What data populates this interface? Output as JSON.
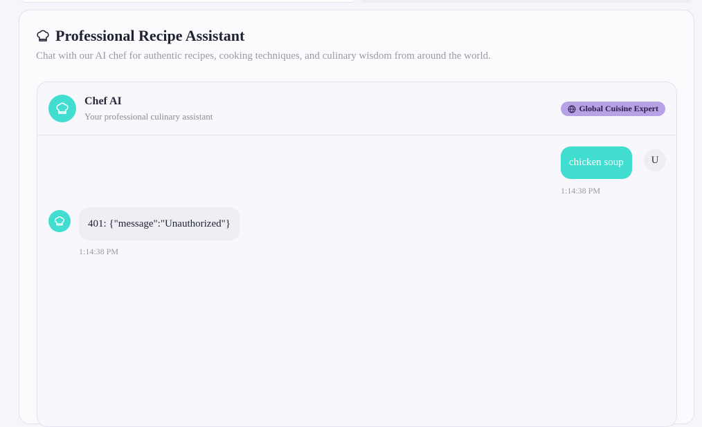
{
  "header": {
    "title": "Professional Recipe Assistant",
    "subtitle": "Chat with our AI chef for authentic recipes, cooking techniques, and culinary wisdom from around the world.",
    "icon": "chef-hat-icon"
  },
  "chat": {
    "assistant": {
      "name": "Chef AI",
      "description": "Your professional culinary assistant",
      "badge": "Global Cuisine Expert",
      "badge_icon": "globe-icon"
    },
    "messages": [
      {
        "role": "user",
        "avatar": "U",
        "text": "chicken soup",
        "time": "1:14:38 PM"
      },
      {
        "role": "assistant",
        "text": "401: {\"message\":\"Unauthorized\"}",
        "time": "1:14:38 PM"
      }
    ]
  },
  "colors": {
    "accent": "#40ddd0",
    "badge": "#b7a2e6",
    "background": "#f6f5fb"
  }
}
